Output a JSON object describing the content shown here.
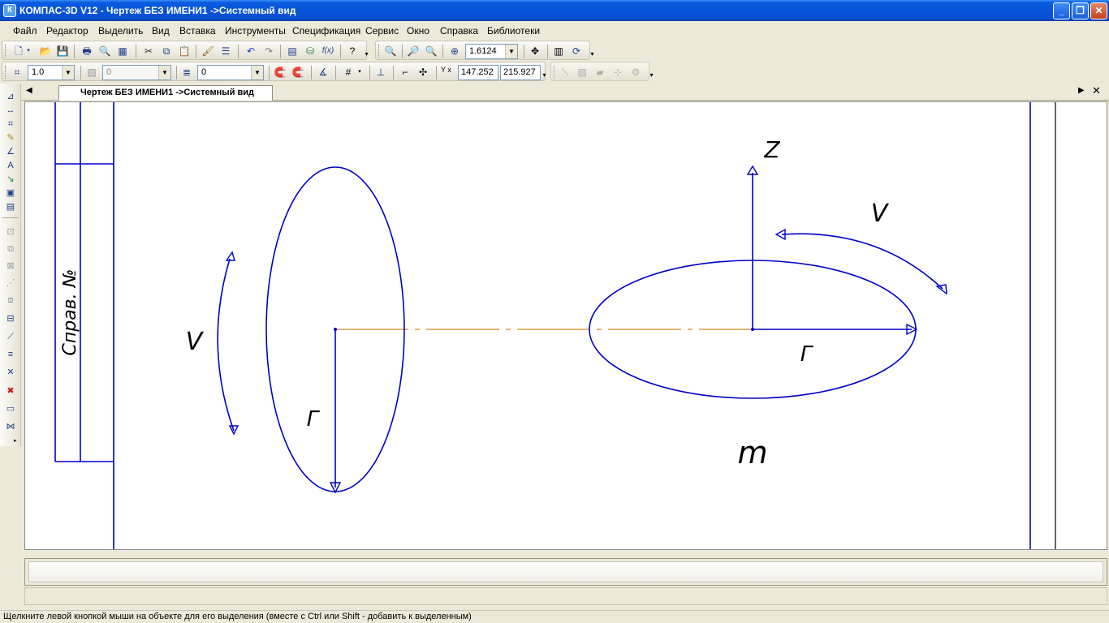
{
  "window": {
    "title": "КОМПАС-3D V12 - Чертеж БЕЗ ИМЕНИ1 ->Системный вид",
    "app_icon": "К",
    "controls": {
      "minimize": "_",
      "restore": "❐",
      "close": "✕"
    }
  },
  "menu": [
    "Файл",
    "Редактор",
    "Выделить",
    "Вид",
    "Вставка",
    "Инструменты",
    "Спецификация",
    "Сервис",
    "Окно",
    "Справка",
    "Библиотеки"
  ],
  "toolbar_main": {
    "zoom_value": "1.6124"
  },
  "toolbar_current_state": {
    "step_value": "1.0",
    "layer_value": "0",
    "style_value": "0",
    "coord_x": "147.252",
    "coord_y": "215.927",
    "coord_label": "Y x"
  },
  "document_tab": {
    "label": "Чертеж БЕЗ ИМЕНИ1 ->Системный вид"
  },
  "drawing": {
    "stamp_text": "Справ. №",
    "left_figure": {
      "velocity_label": "V",
      "radius_label": "Г"
    },
    "right_figure": {
      "axis_label": "Z",
      "velocity_label": "V",
      "radius_label": "Г",
      "mass_label": "m"
    },
    "colors": {
      "line": "#0000c8",
      "axis": "#d28c1e"
    }
  },
  "status": {
    "hint": "Щелкните левой кнопкой мыши на объекте для его выделения (вместе с Ctrl или Shift - добавить к выделенным)"
  }
}
